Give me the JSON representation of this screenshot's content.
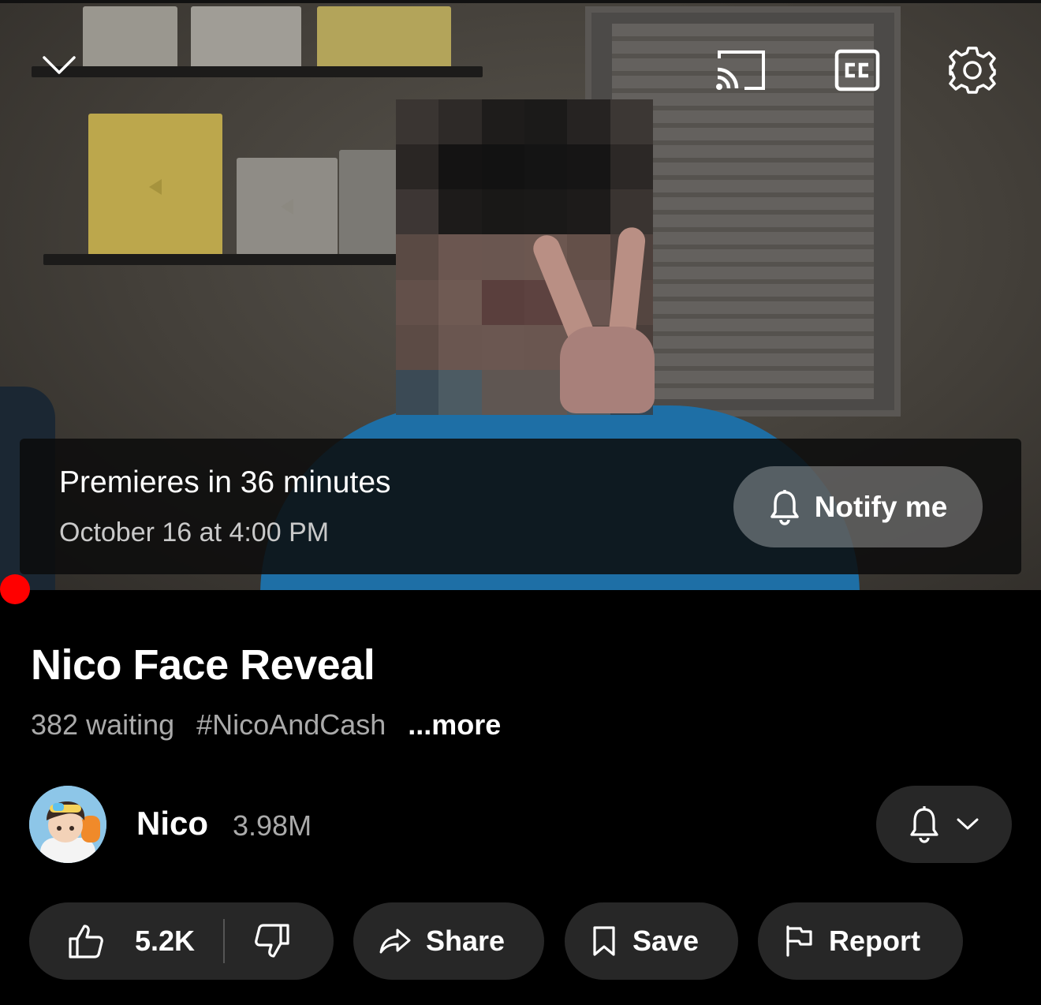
{
  "player": {
    "premiere_title": "Premieres in 36 minutes",
    "premiere_date": "October 16 at 4:00 PM",
    "notify_label": "Notify me",
    "icons": [
      "chevron-down-icon",
      "cast-icon",
      "closed-captions-icon",
      "settings-gear-icon",
      "bell-icon"
    ]
  },
  "video": {
    "title": "Nico Face Reveal",
    "waiting": "382 waiting",
    "hashtag": "#NicoAndCash",
    "more": "...more"
  },
  "channel": {
    "name": "Nico",
    "subscribers": "3.98M"
  },
  "actions": {
    "likes": "5.2K",
    "share": "Share",
    "save": "Save",
    "report": "Report"
  },
  "colors": {
    "background": "#000000",
    "pill": "#272727",
    "progress": "#ff0000",
    "muted_text": "#aaaaaa"
  }
}
